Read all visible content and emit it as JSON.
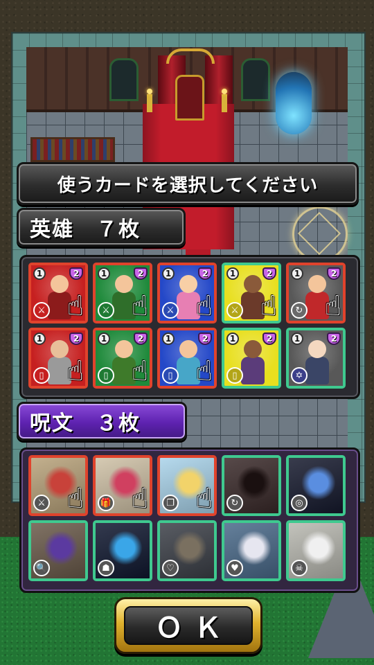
{
  "instruction": "使うカードを選択してください",
  "hero_section": {
    "label": "英雄　７枚",
    "cards": [
      {
        "cost": "1",
        "power": "2",
        "frame": "#e0432c",
        "bg": "#c62020",
        "ibg": "#c62020",
        "icon": "crossed-swords-icon",
        "glyph": "⚔",
        "skin": "#f4c59b",
        "cloth": "#8c1b1b",
        "hand": true
      },
      {
        "cost": "1",
        "power": "2",
        "frame": "#e0432c",
        "bg": "#1f8a3b",
        "ibg": "#1f7a33",
        "icon": "crossed-swords-icon",
        "glyph": "⚔",
        "skin": "#f4c59b",
        "cloth": "#2f6e2a",
        "hand": true
      },
      {
        "cost": "1",
        "power": "2",
        "frame": "#e0432c",
        "bg": "#2448c8",
        "ibg": "#2a4ab3",
        "icon": "crossed-swords-icon",
        "glyph": "⚔",
        "skin": "#f8cfa6",
        "cloth": "#e77fb3",
        "hand": true
      },
      {
        "cost": "1",
        "power": "2",
        "frame": "#3fc98f",
        "bg": "#e8df1f",
        "ibg": "#b3a518",
        "icon": "crossed-swords-icon",
        "glyph": "⚔",
        "skin": "#8a5a3a",
        "cloth": "#6b3a2a",
        "hand": true
      },
      {
        "cost": "1",
        "power": "2",
        "frame": "#e0432c",
        "bg": "#585858",
        "ibg": "#6a6a6a",
        "icon": "cycle-icon",
        "glyph": "↻",
        "skin": "#f4c59b",
        "cloth": "#c0282a",
        "hand": true
      },
      {
        "cost": "1",
        "power": "2",
        "frame": "#e0432c",
        "bg": "#c62020",
        "ibg": "#c62020",
        "icon": "card-icon",
        "glyph": "▯",
        "skin": "#e8c09a",
        "cloth": "#9a9a9a",
        "hand": true
      },
      {
        "cost": "1",
        "power": "2",
        "frame": "#e0432c",
        "bg": "#1f8a3b",
        "ibg": "#1f7a33",
        "icon": "card-icon",
        "glyph": "▯",
        "skin": "#f4c59b",
        "cloth": "#3e7a2a",
        "hand": true
      },
      {
        "cost": "1",
        "power": "2",
        "frame": "#e0432c",
        "bg": "#2448c8",
        "ibg": "#2a4ab3",
        "icon": "card-icon",
        "glyph": "▯",
        "skin": "#f4c59b",
        "cloth": "#47a6c8",
        "hand": true
      },
      {
        "cost": "1",
        "power": "2",
        "frame": "#3fc98f",
        "bg": "#e8df1f",
        "ibg": "#b3a518",
        "icon": "card-icon",
        "glyph": "▯",
        "skin": "#8a5a3a",
        "cloth": "#5b3c7a",
        "hand": false
      },
      {
        "cost": "1",
        "power": "2",
        "frame": "#3fc98f",
        "bg": "#585858",
        "ibg": "#3b3f8a",
        "icon": "hexagram-icon",
        "glyph": "✡",
        "skin": "#f4d8c0",
        "cloth": "#3a4566",
        "hand": false
      }
    ]
  },
  "spell_section": {
    "label": "呪文　３枚",
    "cards": [
      {
        "frame": "#e0432c",
        "bg": "#b8a27a",
        "art": "#c8423a",
        "icon": "crossed-swords-icon",
        "glyph": "⚔",
        "hand": true
      },
      {
        "frame": "#e0432c",
        "bg": "#cfc1a6",
        "art": "#d04060",
        "icon": "gift-icon",
        "glyph": "🎁",
        "hand": true
      },
      {
        "frame": "#e0432c",
        "bg": "#a9d3ea",
        "art": "#f2d36a",
        "icon": "cards-icon",
        "glyph": "❐",
        "hand": true
      },
      {
        "frame": "#3fc98f",
        "bg": "#3a2a2a",
        "art": "#1a1010",
        "icon": "cycle-icon",
        "glyph": "↻",
        "hand": false
      },
      {
        "frame": "#3fc98f",
        "bg": "#161a2e",
        "art": "#5a8ee0",
        "icon": "mirror-icon",
        "glyph": "◎",
        "hand": false
      },
      {
        "frame": "#3fc98f",
        "bg": "#6a5a4a",
        "art": "#5b3aa0",
        "icon": "magnifier-icon",
        "glyph": "🔍",
        "hand": false
      },
      {
        "frame": "#3fc98f",
        "bg": "#101830",
        "art": "#3aa6e8",
        "icon": "ghost-icon",
        "glyph": "☗",
        "hand": false
      },
      {
        "frame": "#3fc98f",
        "bg": "#3c4048",
        "art": "#7a7060",
        "icon": "heart-icon",
        "glyph": "♡",
        "hand": false
      },
      {
        "frame": "#3fc98f",
        "bg": "#4a6a8a",
        "art": "#e6e6f0",
        "icon": "heart-red-icon",
        "glyph": "♥",
        "hand": false
      },
      {
        "frame": "#3fc98f",
        "bg": "#b8b8b0",
        "art": "#f0f0f0",
        "icon": "skull-icon",
        "glyph": "☠",
        "hand": false
      }
    ]
  },
  "ok_label": "ＯＫ"
}
